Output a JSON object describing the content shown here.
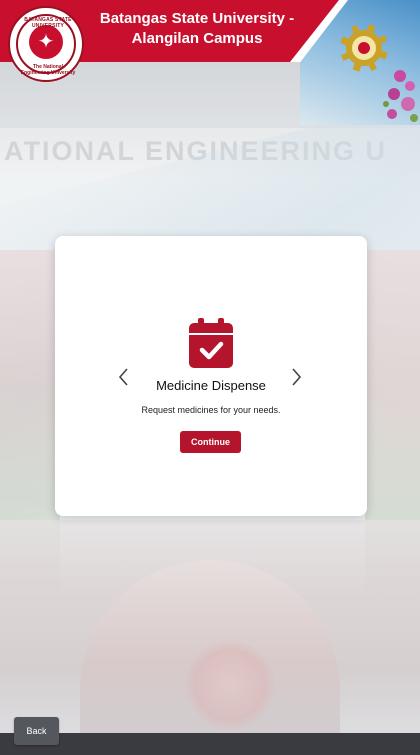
{
  "header": {
    "title_line1": "Batangas State University -",
    "title_line2": "Alangilan Campus",
    "logo": {
      "icon": "university-seal-icon",
      "arc_top": "BATANGAS STATE UNIVERSITY",
      "arc_bottom": "The National Engineering University"
    },
    "seal_icon": "engineering-gear-seal-icon"
  },
  "background": {
    "sign_text": "ATIONAL ENGINEERING U"
  },
  "card": {
    "icon": "calendar-check-icon",
    "title": "Medicine Dispense",
    "description": "Request medicines for your needs.",
    "button_label": "Continue",
    "prev_icon": "chevron-left-icon",
    "next_icon": "chevron-right-icon"
  },
  "footer": {
    "back_label": "Back"
  },
  "colors": {
    "brand_red": "#c8102e",
    "button_red": "#b5142d",
    "footer": "#3a3b40",
    "back_button": "#54575d"
  }
}
